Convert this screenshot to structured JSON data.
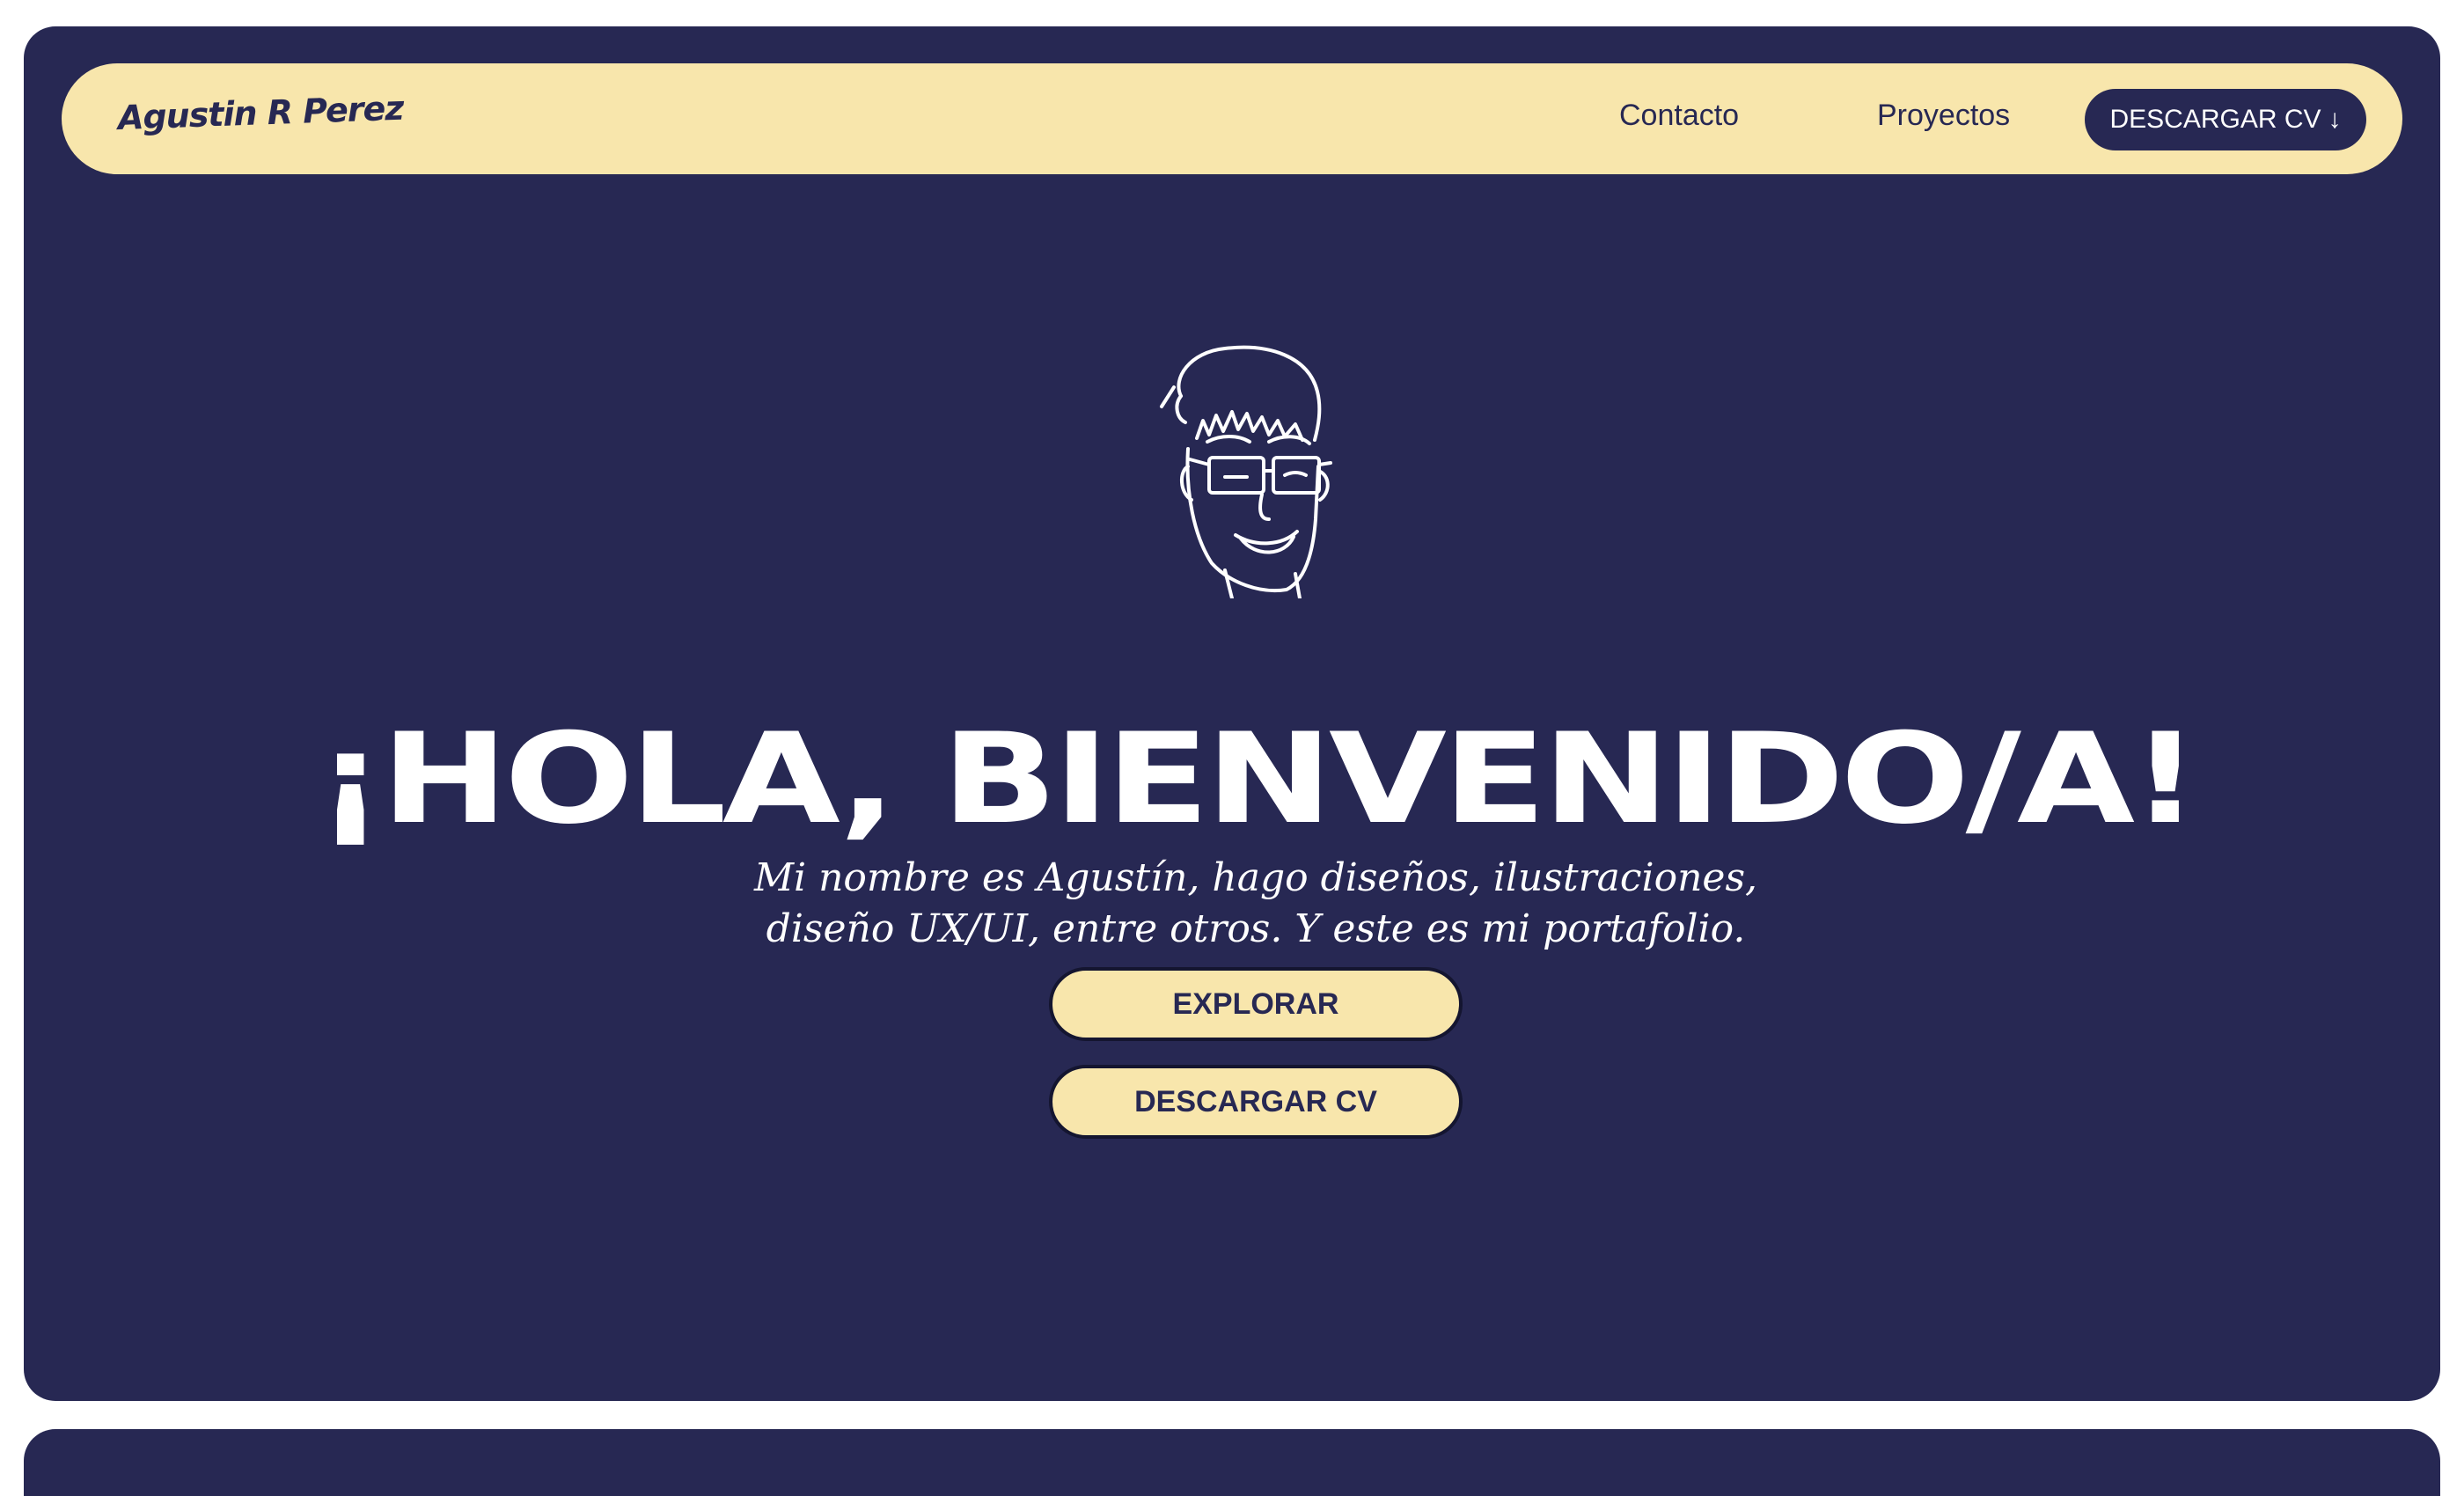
{
  "navbar": {
    "logo": "Agustin R Perez",
    "links": [
      {
        "label": "Contacto"
      },
      {
        "label": "Proyectos"
      }
    ],
    "cv_button": {
      "label": "DESCARGAR CV",
      "icon": "↓"
    }
  },
  "hero": {
    "avatar_icon": "avatar-illustration",
    "headline": "¡HOLA, BIENVENIDO/A!",
    "subtitle_lines": [
      "Mi nombre es Agustín, hago diseños, ilustraciones,",
      "diseño UX/UI, entre otros. Y este es mi portafolio."
    ],
    "buttons": [
      {
        "label": "EXPLORAR"
      },
      {
        "label": "DESCARGAR CV"
      }
    ]
  },
  "colors": {
    "navy": "#272853",
    "cream": "#f8e6ac",
    "white": "#ffffff"
  }
}
